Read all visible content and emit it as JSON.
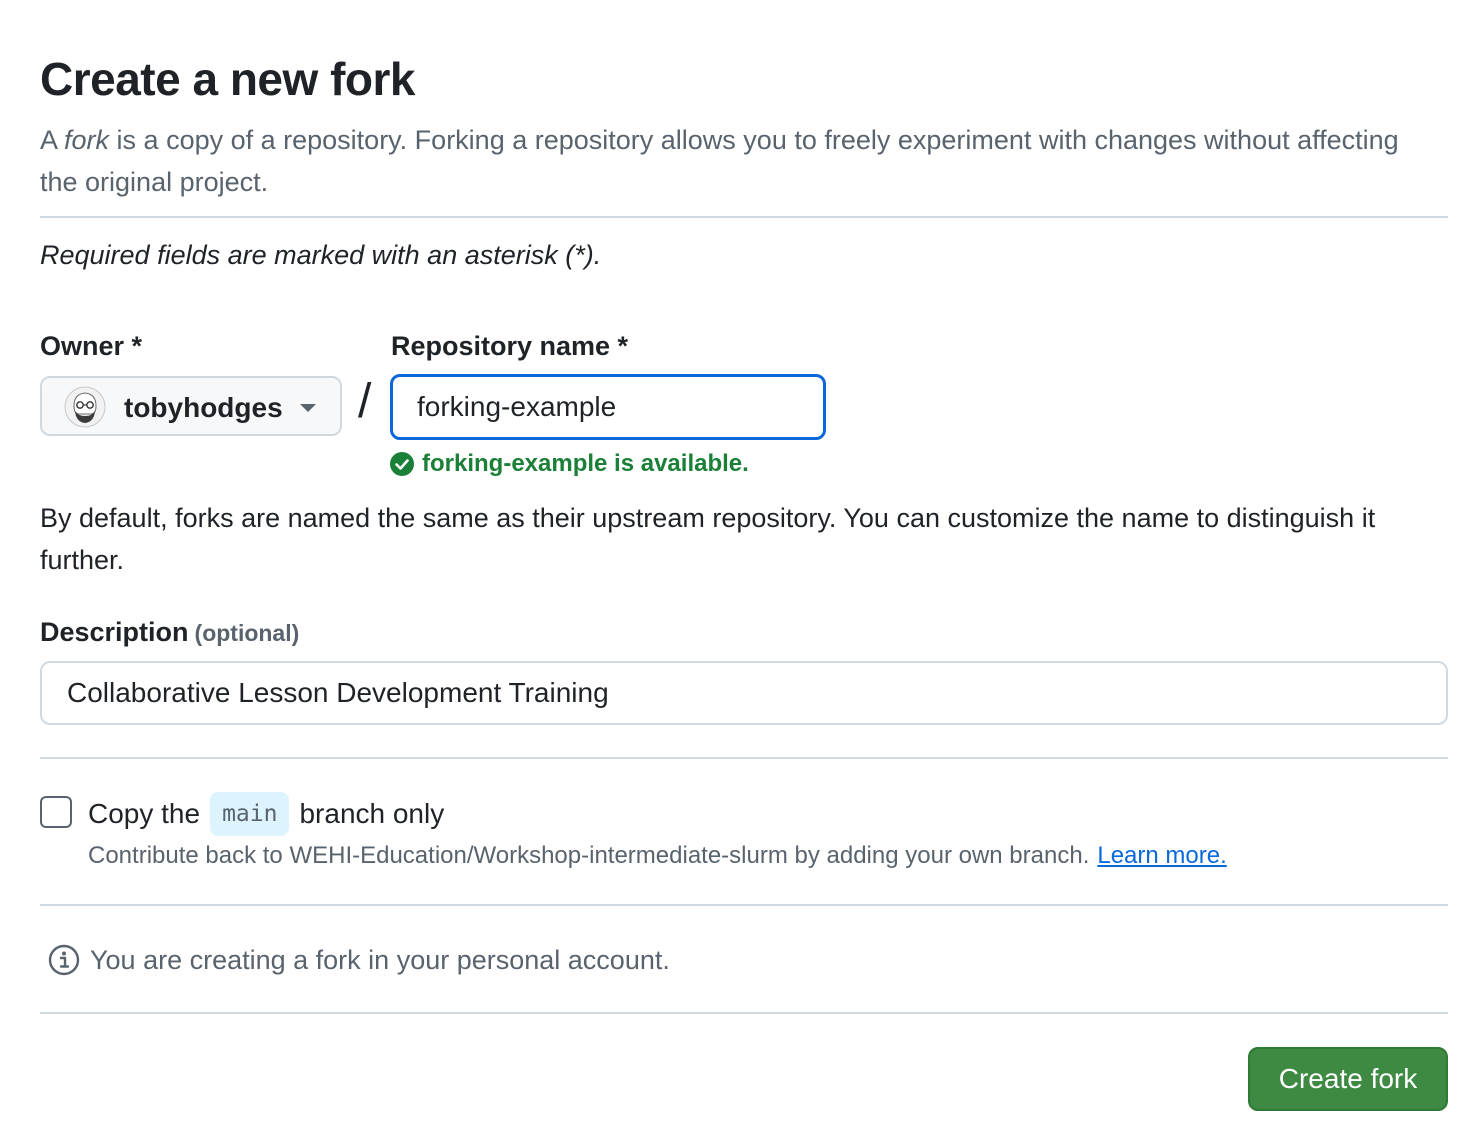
{
  "page": {
    "title": "Create a new fork",
    "intro_prefix": "A ",
    "intro_emphasis": "fork",
    "intro_rest": " is a copy of a repository. Forking a repository allows you to freely experiment with changes without affecting the original project.",
    "required_note": "Required fields are marked with an asterisk (*)."
  },
  "owner": {
    "label": "Owner *",
    "selected": "tobyhodges",
    "icon": "chevron-down-icon"
  },
  "separator": "/",
  "repository": {
    "label": "Repository name *",
    "value": "forking-example",
    "availability": "forking-example is available.",
    "availability_color": "#1a7f37"
  },
  "default_note": "By default, forks are named the same as their upstream repository. You can customize the name to distinguish it further.",
  "description": {
    "label": "Description",
    "optional": "(optional)",
    "value": "Collaborative Lesson Development Training"
  },
  "copy_branch": {
    "checked": false,
    "label_prefix": "Copy the",
    "branch": "main",
    "label_suffix": "branch only",
    "help_text": "Contribute back to WEHI-Education/Workshop-intermediate-slurm by adding your own branch.",
    "learn_more": "Learn more."
  },
  "info": {
    "icon": "info-icon",
    "text": "You are creating a fork in your personal account."
  },
  "actions": {
    "create_label": "Create fork",
    "create_color": "#3e8a43"
  }
}
